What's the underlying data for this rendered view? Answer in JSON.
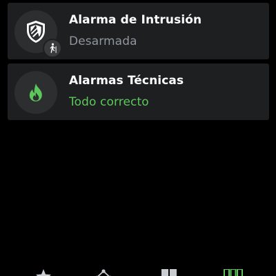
{
  "cards": [
    {
      "title": "Alarma de Intrusión",
      "status": "Desarmada",
      "icon": "shield-icon",
      "badge_icon": "walking-person-icon",
      "status_color": "#8f969d"
    },
    {
      "title": "Alarmas Técnicas",
      "status": "Todo correcto",
      "icon": "flame-icon",
      "status_color": "#5cc85c"
    }
  ],
  "nav": {
    "items": [
      {
        "icon": "star-icon"
      },
      {
        "icon": "network-icon"
      },
      {
        "icon": "grid-icon"
      },
      {
        "icon": "columns-icon",
        "active": true
      }
    ],
    "active_color": "#5cc85c"
  },
  "colors": {
    "background": "#000000",
    "card": "#1e1f20",
    "icon_circle": "#2d2e30",
    "accent_green": "#5cc85c"
  }
}
